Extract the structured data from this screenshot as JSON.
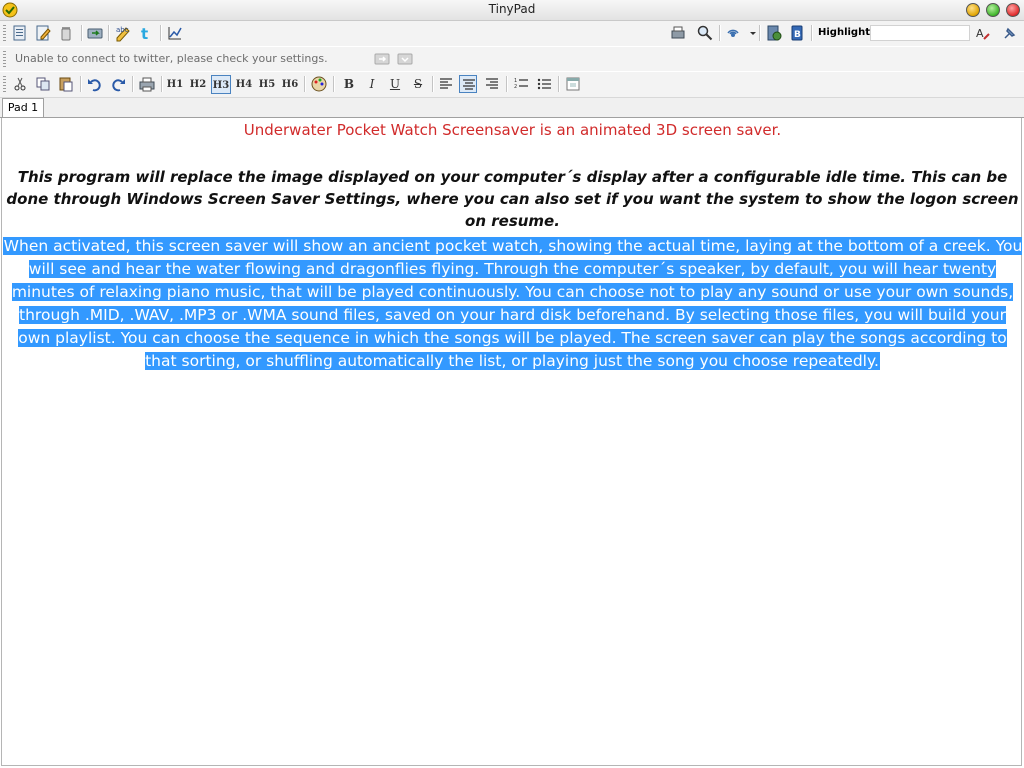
{
  "window": {
    "title": "TinyPad"
  },
  "toolbar1": {
    "highlight_label": "Highlight:",
    "highlight_value": ""
  },
  "toolbar2": {
    "status_message": "Unable to connect to twitter, please check your settings."
  },
  "toolbar3": {
    "headings": [
      "H1",
      "H2",
      "H3",
      "H4",
      "H5",
      "H6"
    ],
    "active_heading": "H3",
    "bold": "B",
    "italic": "I",
    "underline": "U",
    "strike": "S"
  },
  "tabs": [
    {
      "label": "Pad 1"
    }
  ],
  "document": {
    "line1": "Underwater Pocket Watch Screensaver is an animated 3D screen saver.",
    "paragraph2": "This program will replace the image displayed on your computer´s display after a configurable idle time. This can be done through Windows Screen Saver Settings, where you can also set if you want the system to show the logon screen on resume.",
    "paragraph3": "When activated, this screen saver will show an ancient pocket watch, showing the actual time, laying at the bottom of a creek. You will see and hear the water flowing and dragonflies flying. Through the computer´s speaker, by default, you will hear twenty minutes of relaxing piano music, that will be played continuously. You can choose not to play any sound or use your own sounds, through .MID, .WAV, .MP3 or .WMA sound files, saved on your hard disk beforehand. By selecting those files, you will build your own playlist. You can choose the sequence in which the songs will be played. The screen saver can play the songs according to that sorting, or shuffling automatically the list, or playing just the song you choose repeatedly."
  },
  "colors": {
    "line1": "#d12b2b",
    "selection": "#3399ff",
    "toolbar_bg": "#f3f3f3"
  }
}
